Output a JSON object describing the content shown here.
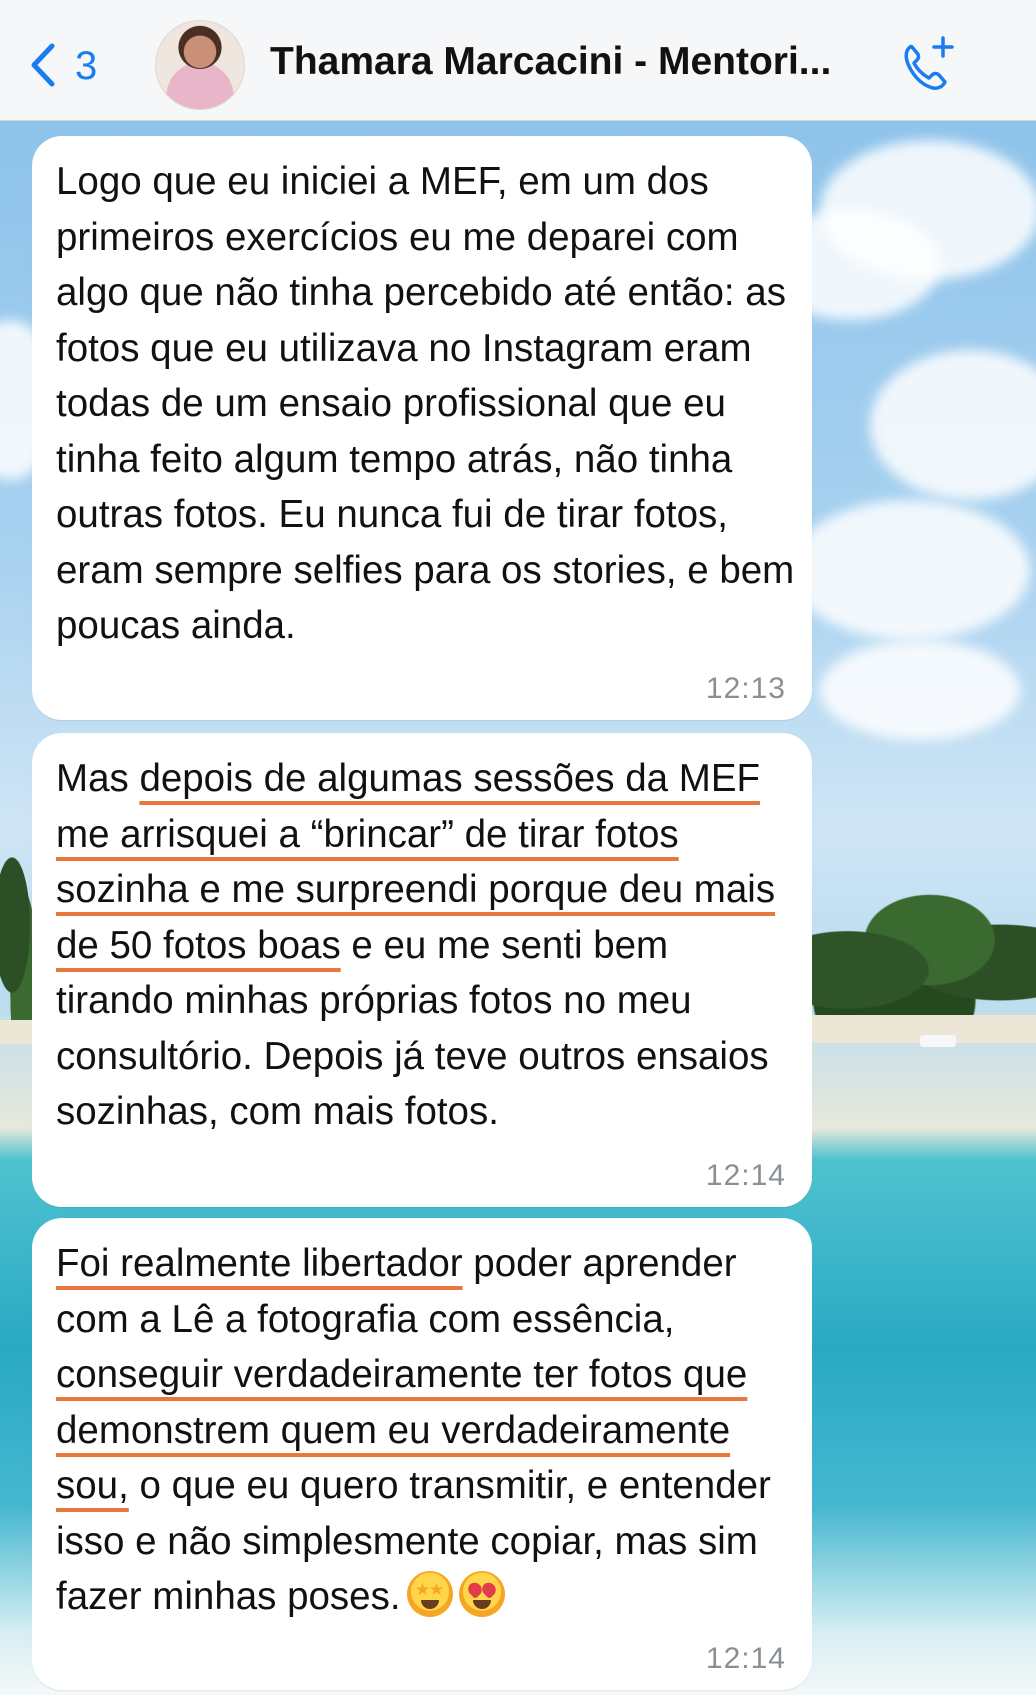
{
  "header": {
    "back_count": "3",
    "contact_name": "Thamara Marcacini - Mentori...",
    "icons": [
      "chevron-left-icon",
      "avatar",
      "phone-add-icon"
    ],
    "accent_color": "#1a7cf2"
  },
  "messages": [
    {
      "text": "Logo que eu iniciei a MEF, em um dos primeiros exercícios eu me deparei com algo que não tinha percebido até então: as fotos que eu utilizava no Instagram eram todas de um ensaio profissional que eu tinha feito algum tempo atrás, não tinha outras fotos. Eu nunca fui de tirar fotos, eram sempre selfies para os stories, e bem poucas ainda.",
      "time": "12:13"
    },
    {
      "part1": "Mas ",
      "underlined": "depois de algumas sessões da MEF me arrisquei a “brincar” de tirar fotos sozinha e me surpreendi porque deu mais de 50 fotos boas",
      "part2": " e eu me senti bem tirando minhas próprias fotos no meu consultório. Depois já teve outros ensaios sozinhas, com mais fotos.",
      "time": "12:14"
    },
    {
      "underlined1": "Foi realmente libertador",
      "part1": " poder aprender com a Lê a fotografia com essência, ",
      "underlined2": "conseguir verdadeiramente ter fotos que demonstrem quem eu verdadeiramente sou,",
      "part2": " o que eu quero transmitir, e entender isso e não simplesmente copiar, mas sim fazer minhas poses.",
      "emojis": [
        "star-struck-emoji",
        "heart-eyes-emoji"
      ],
      "time": "12:14",
      "underline_color": "#e8773d"
    }
  ]
}
